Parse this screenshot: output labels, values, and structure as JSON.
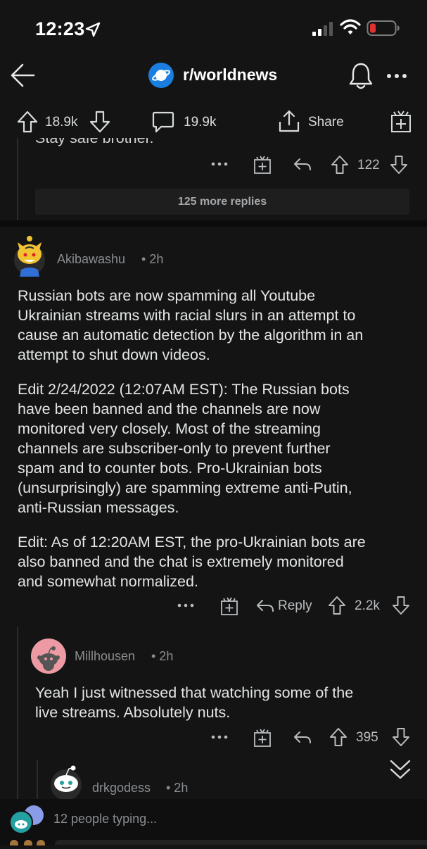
{
  "status_bar": {
    "time": "12:23"
  },
  "header": {
    "subreddit": "r/worldnews"
  },
  "post_bar": {
    "upvotes": "18.9k",
    "comments": "19.9k",
    "share_label": "Share"
  },
  "prev_thread": {
    "cut_text": "Stay safe brother.",
    "vote_count": "122",
    "more_replies": "125 more replies"
  },
  "comment1": {
    "author": "Akibawashu",
    "time": "• 2h",
    "paragraphs": [
      [
        "Russian bots are now spamming all Youtube",
        "Ukrainian streams with racial slurs in an attempt to",
        "cause an automatic detection by the algorithm in an",
        "attempt to shut down videos."
      ],
      [
        "Edit 2/24/2022 (12:07AM EST): The Russian bots",
        "have been banned and the channels are now",
        "monitored very closely. Most of the streaming",
        "channels are subscriber-only to prevent further",
        "spam and to counter bots. Pro-Ukrainian bots",
        "(unsurprisingly) are spamming extreme anti-Putin,",
        "anti-Russian messages."
      ],
      [
        "Edit: As of 12:20AM EST, the pro-Ukrainian bots are",
        "also banned and the chat is extremely monitored",
        "and somewhat normalized."
      ]
    ],
    "reply_label": "Reply",
    "vote_count": "2.2k"
  },
  "comment2": {
    "author": "Millhousen",
    "time": "• 2h",
    "lines": [
      "Yeah I just witnessed that watching some of the",
      "live streams.  Absolutely nuts."
    ],
    "vote_count": "395"
  },
  "comment3": {
    "author": "drkgodess",
    "time": "• 2h"
  },
  "typing": {
    "text": "12 people typing..."
  },
  "colors": {
    "background": "#141414",
    "text": "#d7dadc",
    "subreddit_icon": "#1a7ee0",
    "battery_low": "#e0312f"
  }
}
